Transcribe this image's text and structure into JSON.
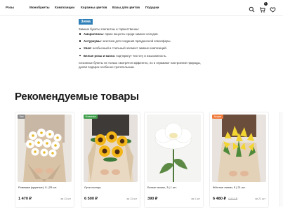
{
  "nav": {
    "items": [
      "Розы",
      "Монобукеты",
      "Композиции",
      "Корзины цветов",
      "Вазы для цветов",
      "Подарки"
    ],
    "icons": [
      "search-icon",
      "cart-icon",
      "heart-icon"
    ],
    "cart_count": "1"
  },
  "season": {
    "tag": "Зима",
    "intro": "Зимние букеты элегантны и торжественны:",
    "bullets": [
      {
        "term": "Амариллисы",
        "text": ": яркие акценты среди зимних холодов."
      },
      {
        "term": "Антуриумы",
        "text": ": экзотика для создания праздничной атмосферы."
      },
      {
        "term": "Хвоя",
        "text": ": необычный и стильный элемент зимних композиций."
      },
      {
        "term": "Белые розы и калла",
        "text": ": подчеркнут чистоту и изысканность."
      }
    ],
    "outro": "Сезонные букеты не только смотрятся эффектно, но и отражают настроение природы, делая подарок особенно трогательным."
  },
  "recommended": {
    "title": "Рекомендуемые товары",
    "products": [
      {
        "chip": "Хит",
        "chip_color": "#8a8a8a",
        "name": "Ромашки (крупные), 5 | 25 шт.",
        "price": "1 470 ₽",
        "old_price": "",
        "note": "за 11 шт"
      },
      {
        "chip": "Новинка",
        "chip_color": "#3f9e4b",
        "name": "Лучи солнца",
        "price": "6 500 ₽",
        "old_price": "",
        "note": "за 11 шт"
      },
      {
        "chip": "",
        "chip_color": "",
        "name": "Белые пионы, 3 | 1 шт.",
        "price": "390 ₽",
        "old_price": "",
        "note": "за 1 шт"
      },
      {
        "chip": "Акция",
        "chip_color": "#f07a3a",
        "name": "Жёлтые лилии, 5 | 21 шт.",
        "price": "6 480 ₽",
        "old_price": "6 815 ₽",
        "note": "за 21 шт"
      }
    ]
  }
}
